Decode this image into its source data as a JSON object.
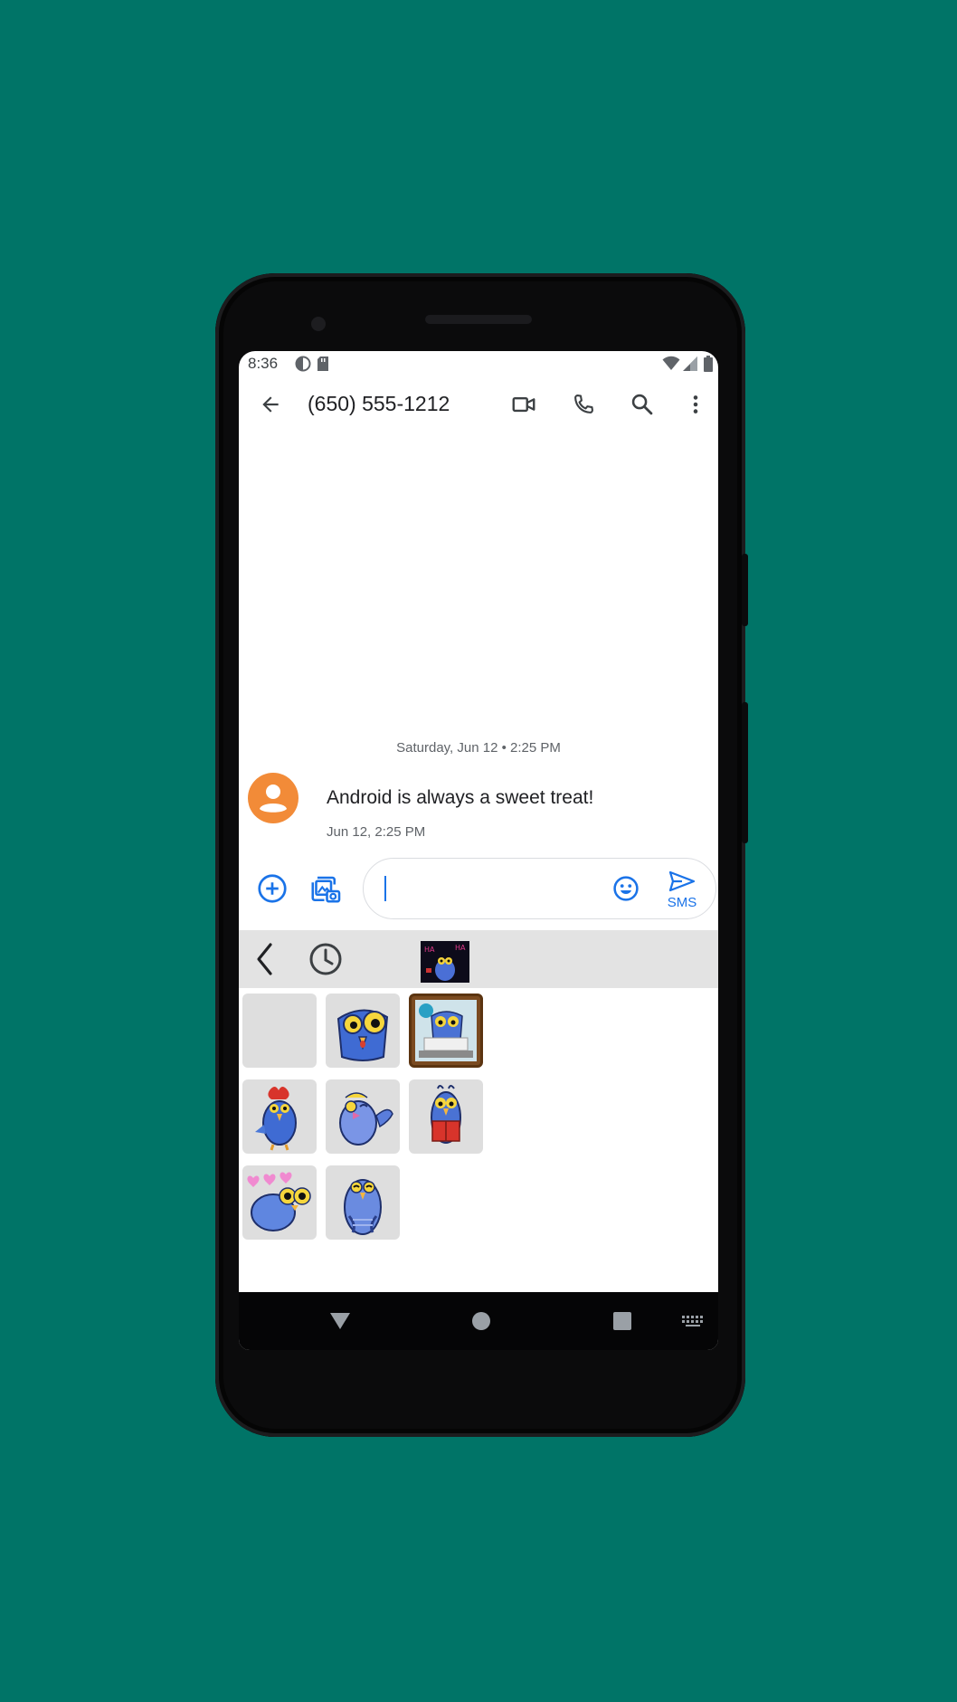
{
  "status_bar": {
    "time": "8:36"
  },
  "app_bar": {
    "title": "(650) 555-1212"
  },
  "conversation": {
    "date_separator": "Saturday, Jun 12 • 2:25 PM",
    "messages": [
      {
        "text": "Android is always a sweet treat!",
        "timestamp": "Jun 12, 2:25 PM"
      }
    ]
  },
  "composer": {
    "input_value": "",
    "send_label": "SMS"
  },
  "sticker_tray": {
    "stickers": [
      "empty",
      "surprised-bird",
      "bird-at-computer",
      "rooster-bird",
      "waving-bird",
      "bird-reading-book",
      "bird-with-hearts",
      "crying-bird"
    ]
  },
  "colors": {
    "background": "#007467",
    "accent": "#1a73e8",
    "avatar": "#f28b38",
    "sticker_bar": "#e3e3e3"
  },
  "icons": {
    "app_bar": [
      "back-arrow-icon",
      "video-call-icon",
      "phone-icon",
      "search-icon",
      "more-vert-icon"
    ],
    "composer": [
      "add-circle-icon",
      "gallery-icon",
      "emoji-icon",
      "send-icon"
    ],
    "sticker_bar": [
      "chevron-left-icon",
      "recent-clock-icon",
      "sticker-pack-thumbnail"
    ],
    "nav": [
      "nav-back-icon",
      "nav-home-icon",
      "nav-recents-icon",
      "keyboard-icon"
    ]
  }
}
